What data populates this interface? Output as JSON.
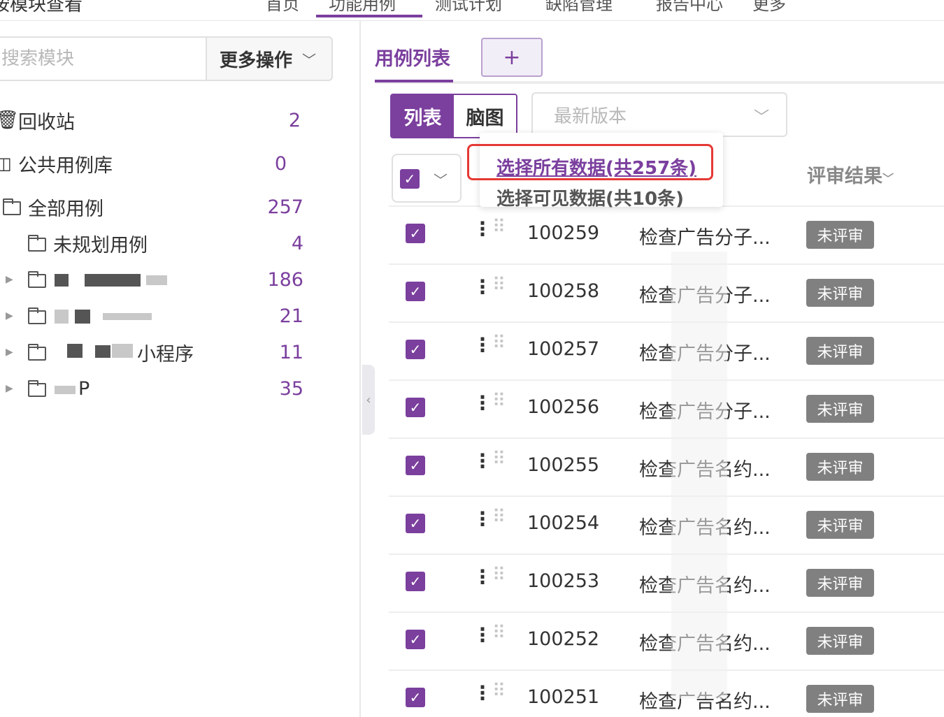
{
  "topnav": {
    "title": "按模块查看",
    "tabs": [
      "首页",
      "功能用例",
      "测试计划",
      "缺陷管理",
      "报告中心",
      "更多"
    ]
  },
  "left": {
    "search_placeholder": "搜索模块",
    "more_actions": "更多操作",
    "tree": [
      {
        "label": "回收站",
        "count": "2"
      },
      {
        "label": "公共用例库",
        "count": "0"
      },
      {
        "label": "全部用例",
        "count": "257"
      },
      {
        "label": "未规划用例",
        "count": "4"
      },
      {
        "label": "",
        "count": "186"
      },
      {
        "label": "",
        "count": "21"
      },
      {
        "label": "小程序",
        "count": "11"
      },
      {
        "label": "P",
        "count": "35"
      }
    ]
  },
  "right": {
    "tab_label": "用例列表",
    "add_tab": "+",
    "view_list": "列表",
    "view_mind": "脑图",
    "version_placeholder": "最新版本",
    "column_review": "评审结果",
    "popup_select_all": "选择所有数据(共257条)",
    "popup_select_visible": "选择可见数据(共10条)",
    "rows": [
      {
        "id": "100259",
        "title": "检查广告分子...",
        "review": "未评审"
      },
      {
        "id": "100258",
        "title": "检查广告分子...",
        "review": "未评审"
      },
      {
        "id": "100257",
        "title": "检查广告分子...",
        "review": "未评审"
      },
      {
        "id": "100256",
        "title": "检查广告分子...",
        "review": "未评审"
      },
      {
        "id": "100255",
        "title": "检查广告名约...",
        "review": "未评审"
      },
      {
        "id": "100254",
        "title": "检查广告名约...",
        "review": "未评审"
      },
      {
        "id": "100253",
        "title": "检查广告名约...",
        "review": "未评审"
      },
      {
        "id": "100252",
        "title": "检查广告名约...",
        "review": "未评审"
      },
      {
        "id": "100251",
        "title": "检查广告名约...",
        "review": "未评审"
      }
    ]
  },
  "colors": {
    "accent": "#7b3f9e",
    "badge": "#808080",
    "highlight": "#e53935"
  },
  "icons": [
    "checkbox-checked-icon",
    "more-vertical-icon",
    "drag-handle-icon",
    "chevron-down-icon",
    "folder-icon",
    "trash-icon",
    "plus-icon"
  ]
}
